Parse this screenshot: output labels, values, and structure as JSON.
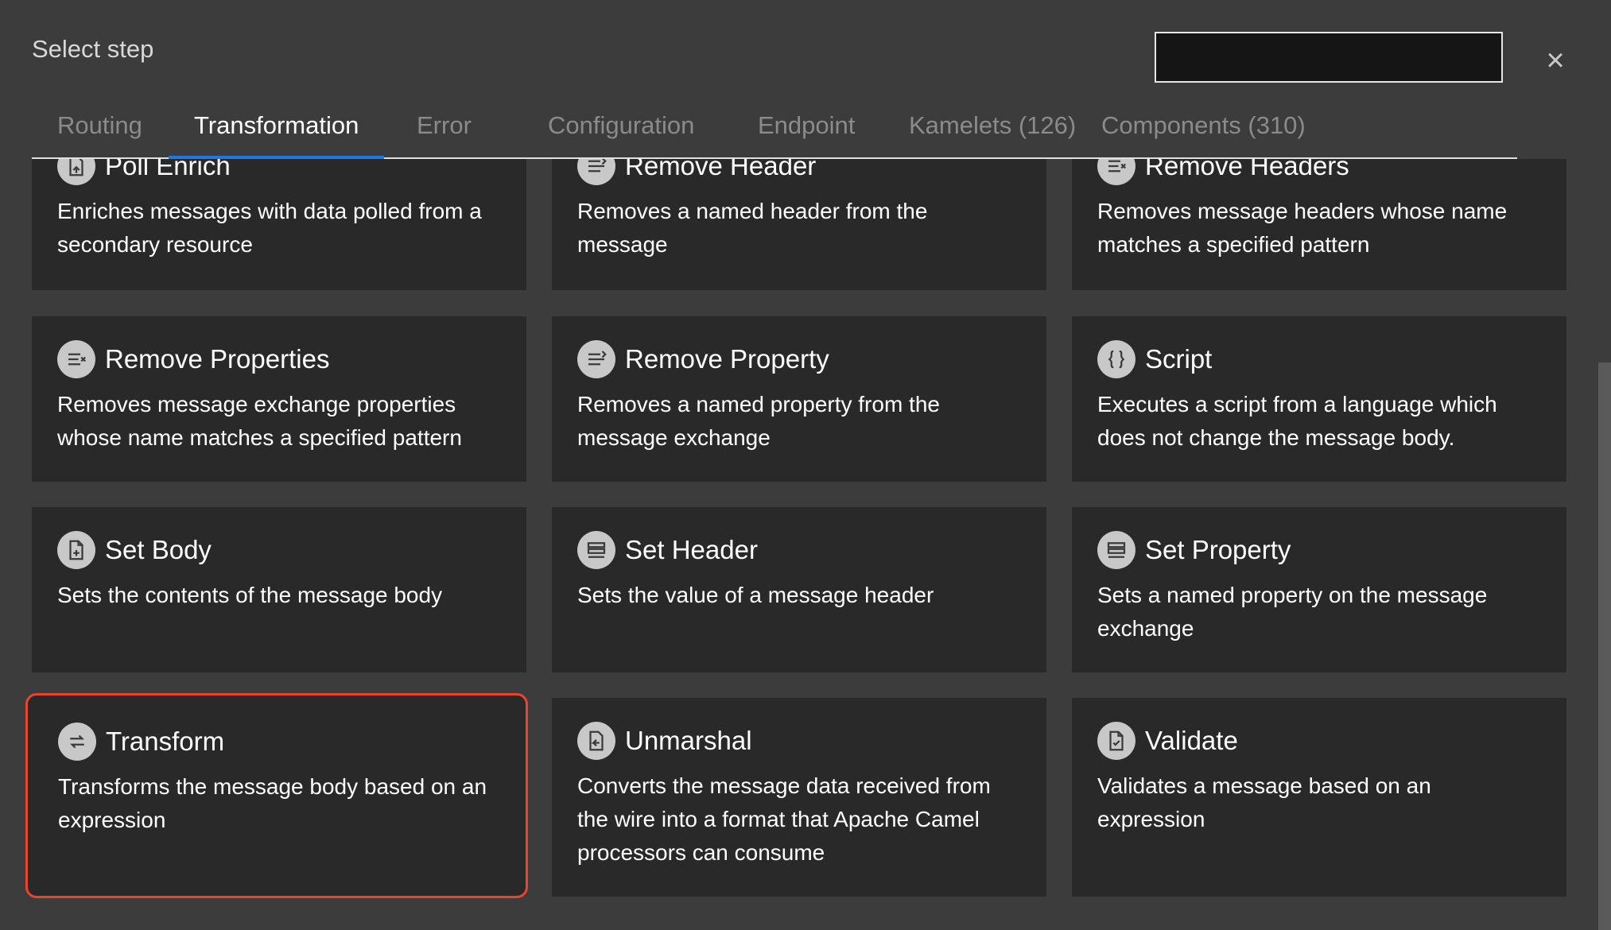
{
  "dialog": {
    "title": "Select step",
    "search": {
      "value": "",
      "placeholder": ""
    },
    "close_label": "×"
  },
  "tabs": [
    {
      "label": "Routing",
      "active": false
    },
    {
      "label": "Transformation",
      "active": true
    },
    {
      "label": "Error",
      "active": false
    },
    {
      "label": "Configuration",
      "active": false
    },
    {
      "label": "Endpoint",
      "active": false
    },
    {
      "label": "Kamelets (126)",
      "active": false
    },
    {
      "label": "Components (310)",
      "active": false
    }
  ],
  "cards": [
    {
      "title": "Poll Enrich",
      "description": "Enriches messages with data polled from a secondary resource",
      "icon": "poll-enrich-icon"
    },
    {
      "title": "Remove Header",
      "description": "Removes a named header from the message",
      "icon": "remove-header-icon"
    },
    {
      "title": "Remove Headers",
      "description": "Removes message headers whose name matches a specified pattern",
      "icon": "remove-headers-icon"
    },
    {
      "title": "Remove Properties",
      "description": "Removes message exchange properties whose name matches a specified pattern",
      "icon": "remove-properties-icon"
    },
    {
      "title": "Remove Property",
      "description": "Removes a named property from the message exchange",
      "icon": "remove-property-icon"
    },
    {
      "title": "Script",
      "description": "Executes a script from a language which does not change the message body.",
      "icon": "script-icon"
    },
    {
      "title": "Set Body",
      "description": "Sets the contents of the message body",
      "icon": "set-body-icon"
    },
    {
      "title": "Set Header",
      "description": "Sets the value of a message header",
      "icon": "set-header-icon"
    },
    {
      "title": "Set Property",
      "description": "Sets a named property on the message exchange",
      "icon": "set-property-icon"
    },
    {
      "title": "Transform",
      "description": "Transforms the message body based on an expression",
      "icon": "transform-icon",
      "selected": true
    },
    {
      "title": "Unmarshal",
      "description": "Converts the message data received from the wire into a format that Apache Camel processors can consume",
      "icon": "unmarshal-icon"
    },
    {
      "title": "Validate",
      "description": "Validates a message based on an expression",
      "icon": "validate-icon"
    }
  ],
  "colors": {
    "background": "#3c3c3c",
    "card": "#292929",
    "active_tab_underline": "#1f7be0",
    "selected_border": "#e8452f"
  }
}
